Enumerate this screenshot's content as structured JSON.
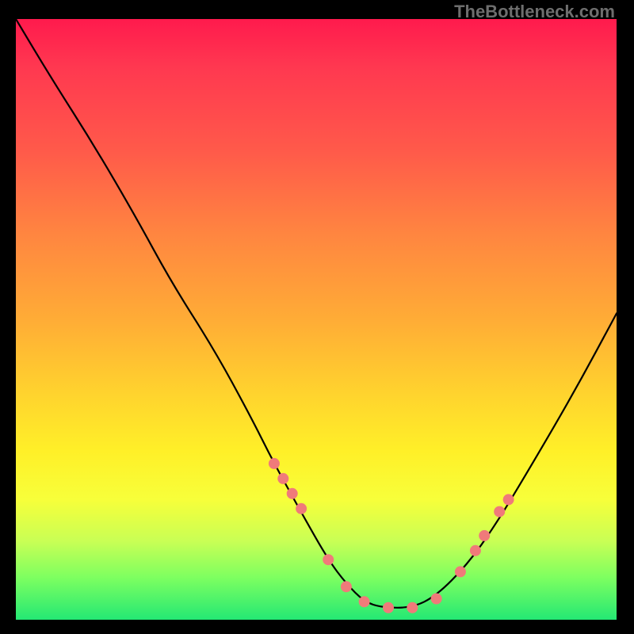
{
  "watermark": "TheBottleneck.com",
  "chart_data": {
    "type": "line",
    "title": "",
    "xlabel": "",
    "ylabel": "",
    "xlim": [
      0,
      100
    ],
    "ylim": [
      0,
      100
    ],
    "series": [
      {
        "name": "curve",
        "x": [
          0,
          6,
          13,
          20,
          26,
          33,
          39,
          43,
          48,
          52,
          55,
          58,
          61,
          66,
          70,
          75,
          80,
          86,
          93,
          100
        ],
        "y": [
          100,
          90,
          79,
          67,
          56,
          45,
          34,
          26,
          17,
          10,
          6,
          3,
          2,
          2,
          4,
          9,
          16,
          26,
          38,
          51
        ]
      }
    ],
    "dots": {
      "name": "dots",
      "color": "#f07a7a",
      "x": [
        43,
        44.5,
        46,
        47.5,
        52,
        55,
        58,
        62,
        66,
        70,
        74,
        76.5,
        78,
        80.5,
        82
      ],
      "y": [
        26,
        23.5,
        21,
        18.5,
        10,
        5.5,
        3,
        2,
        2,
        3.5,
        8,
        11.5,
        14,
        18,
        20
      ]
    },
    "background_gradient": {
      "top": "#ff1a4d",
      "mid": "#ffd22e",
      "bottom": "#24e874"
    }
  }
}
